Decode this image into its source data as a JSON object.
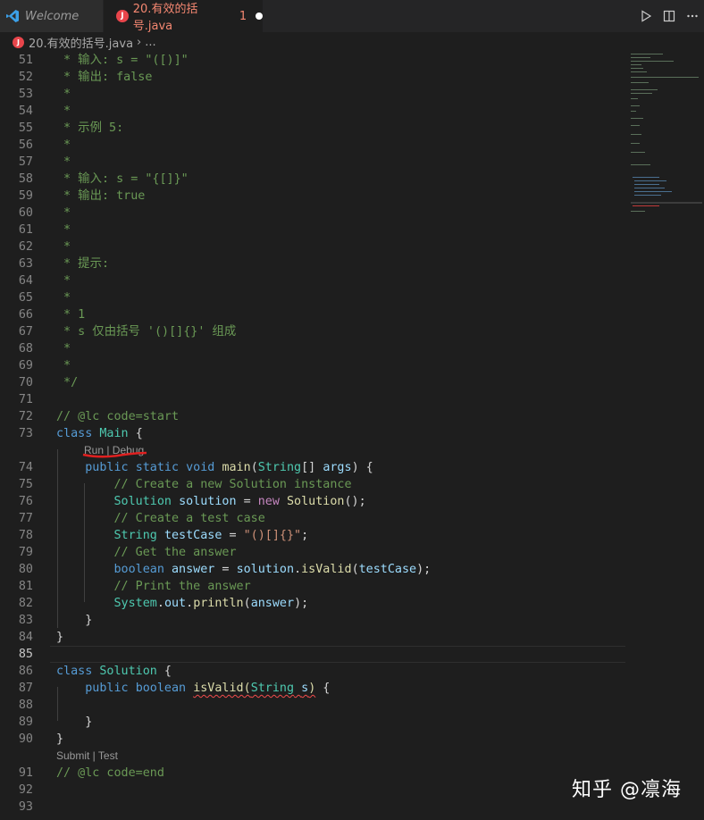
{
  "tabs": [
    {
      "label": "Welcome"
    },
    {
      "label": "20.有效的括号.java",
      "problem_count": "1"
    }
  ],
  "java_badge": "J",
  "breadcrumb": {
    "file": "20.有效的括号.java",
    "rest": "..."
  },
  "lenses": {
    "run_debug": "Run | Debug",
    "submit_test": "Submit | Test"
  },
  "lines": [
    {
      "n": "51",
      "text": " * 输入: s = \"([)]\""
    },
    {
      "n": "52",
      "text": " * 输出: false"
    },
    {
      "n": "53",
      "text": " *"
    },
    {
      "n": "54",
      "text": " *"
    },
    {
      "n": "55",
      "text": " * 示例 5:"
    },
    {
      "n": "56",
      "text": " *"
    },
    {
      "n": "57",
      "text": " *"
    },
    {
      "n": "58",
      "text": " * 输入: s = \"{[]}\""
    },
    {
      "n": "59",
      "text": " * 输出: true"
    },
    {
      "n": "60",
      "text": " *"
    },
    {
      "n": "61",
      "text": " *"
    },
    {
      "n": "62",
      "text": " *"
    },
    {
      "n": "63",
      "text": " * 提示:"
    },
    {
      "n": "64",
      "text": " *"
    },
    {
      "n": "65",
      "text": " *"
    },
    {
      "n": "66",
      "text": " * 1"
    },
    {
      "n": "67",
      "text": " * s 仅由括号 '()[]{}' 组成"
    },
    {
      "n": "68",
      "text": " *"
    },
    {
      "n": "69",
      "text": " *"
    },
    {
      "n": "70",
      "text": " */"
    },
    {
      "n": "71",
      "text": ""
    },
    {
      "n": "72",
      "text": "// @lc code=start"
    },
    {
      "n": "73",
      "text": "class Main {"
    },
    {
      "n": "74",
      "text": "    public static void main(String[] args) {"
    },
    {
      "n": "75",
      "text": "        // Create a new Solution instance"
    },
    {
      "n": "76",
      "text": "        Solution solution = new Solution();"
    },
    {
      "n": "77",
      "text": "        // Create a test case"
    },
    {
      "n": "78",
      "text": "        String testCase = \"()[]{}\";"
    },
    {
      "n": "79",
      "text": "        // Get the answer"
    },
    {
      "n": "80",
      "text": "        boolean answer = solution.isValid(testCase);"
    },
    {
      "n": "81",
      "text": "        // Print the answer"
    },
    {
      "n": "82",
      "text": "        System.out.println(answer);"
    },
    {
      "n": "83",
      "text": "    }"
    },
    {
      "n": "84",
      "text": "}"
    },
    {
      "n": "85",
      "text": ""
    },
    {
      "n": "86",
      "text": "class Solution {"
    },
    {
      "n": "87",
      "text": "    public boolean isValid(String s) {"
    },
    {
      "n": "88",
      "text": ""
    },
    {
      "n": "89",
      "text": "    }"
    },
    {
      "n": "90",
      "text": "}"
    },
    {
      "n": "91",
      "text": "// @lc code=end"
    },
    {
      "n": "92",
      "text": ""
    },
    {
      "n": "93",
      "text": ""
    }
  ],
  "watermark": "知乎 @凛海",
  "colors": {
    "comment": "#6a9955",
    "keyword": "#569cd6",
    "type": "#4ec9b0",
    "string": "#ce9178",
    "error": "#f14c4c"
  }
}
